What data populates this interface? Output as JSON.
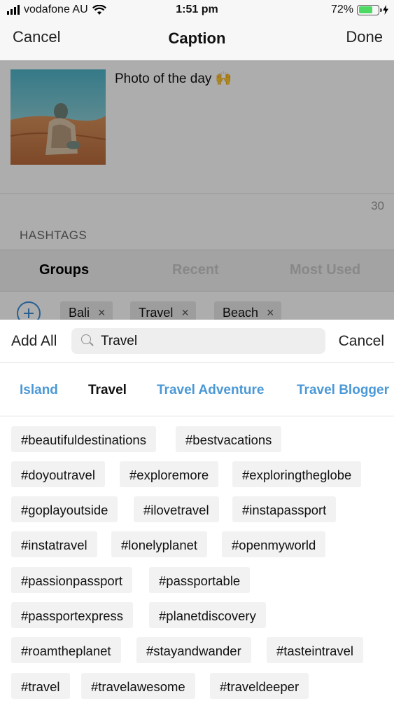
{
  "status_bar": {
    "carrier": "vodafone AU",
    "time": "1:51 pm",
    "battery_percent": "72%",
    "battery_level": 0.72
  },
  "nav": {
    "cancel_label": "Cancel",
    "title": "Caption",
    "done_label": "Done"
  },
  "caption": {
    "text": "Photo of the day 🙌",
    "char_count": "30"
  },
  "hashtags_section": {
    "label": "HASHTAGS",
    "tabs": [
      "Groups",
      "Recent",
      "Most Used"
    ],
    "active_tab": "Groups",
    "groups": [
      "Bali",
      "Travel",
      "Beach"
    ],
    "remove_glyph": "×"
  },
  "search": {
    "add_all_label": "Add All",
    "query": "Travel",
    "cancel_label": "Cancel"
  },
  "categories": {
    "items": [
      "Island",
      "Travel",
      "Travel Adventure",
      "Travel Blogger"
    ],
    "active": "Travel",
    "accent_color": "#4a98d6"
  },
  "tags": [
    "#beautifuldestinations",
    "#bestvacations",
    "#doyoutravel",
    "#exploremore",
    "#exploringtheglobe",
    "#goplayoutside",
    "#ilovetravel",
    "#instapassport",
    "#instatravel",
    "#lonelyplanet",
    "#openmyworld",
    "#passionpassport",
    "#passportable",
    "#passportexpress",
    "#planetdiscovery",
    "#roamtheplanet",
    "#stayandwander",
    "#tasteintravel",
    "#travel",
    "#travelawesome",
    "#traveldeeper"
  ]
}
